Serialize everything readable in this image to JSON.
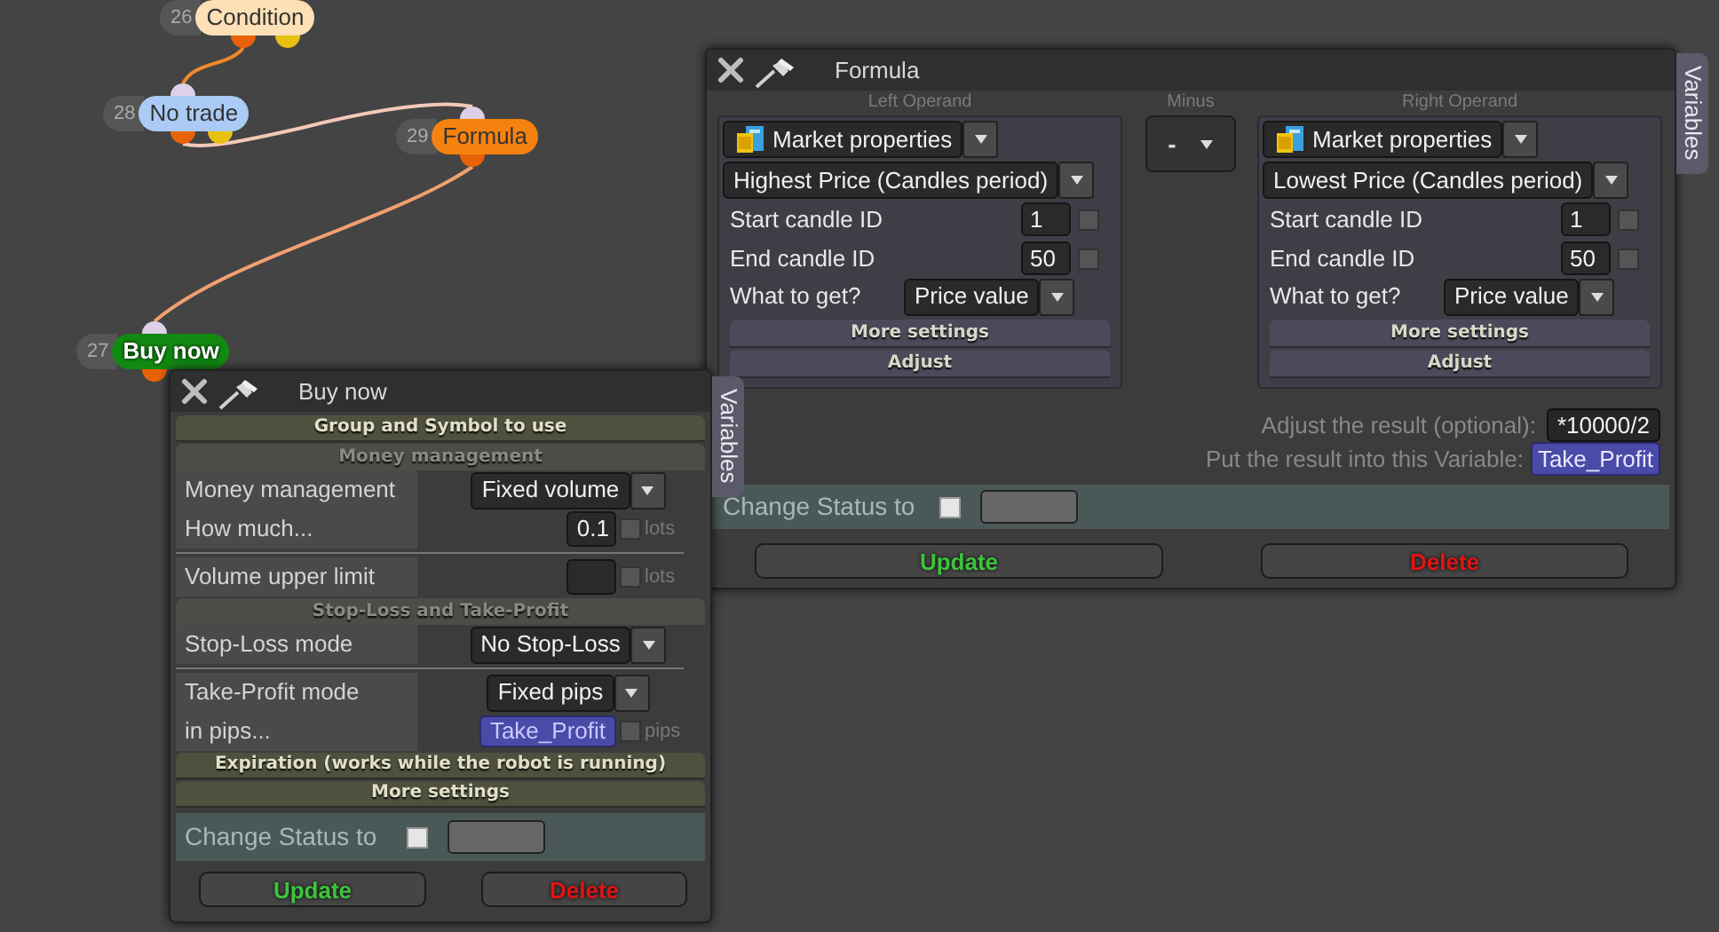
{
  "nodes": [
    {
      "number": "26",
      "label": "Condition",
      "color": "#fde0b5",
      "kind": "light"
    },
    {
      "number": "28",
      "label": "No trade",
      "color": "#aacbf5",
      "kind": "light"
    },
    {
      "number": "29",
      "label": "Formula",
      "color": "#f5820f",
      "kind": "light"
    },
    {
      "number": "27",
      "label": "Buy now",
      "color": "#128a12",
      "kind": "strong"
    }
  ],
  "formula_window": {
    "title": "Formula",
    "tab": "Variables",
    "operands": [
      {
        "label": "Left Operand",
        "source": "Market properties",
        "property": "Highest Price (Candles period)",
        "fields": [
          {
            "label": "Start candle ID",
            "value": "1",
            "checked": false
          },
          {
            "label": "End candle ID",
            "value": "50",
            "checked": false
          }
        ],
        "what_label": "What to get?",
        "what_value": "Price value",
        "sections": [
          "More settings",
          "Adjust"
        ]
      },
      {
        "label": "Right Operand",
        "source": "Market properties",
        "property": "Lowest Price (Candles period)",
        "fields": [
          {
            "label": "Start candle ID",
            "value": "1",
            "checked": false
          },
          {
            "label": "End candle ID",
            "value": "50",
            "checked": false
          }
        ],
        "what_label": "What to get?",
        "what_value": "Price value",
        "sections": [
          "More settings",
          "Adjust"
        ]
      }
    ],
    "operator": {
      "label": "Minus",
      "value": "-"
    },
    "adjust": {
      "label": "Adjust the result (optional):",
      "value": "*10000/2"
    },
    "result": {
      "label": "Put the result into this Variable:",
      "value": "Take_Profit"
    },
    "change_status": {
      "label": "Change Status to",
      "checked": false
    },
    "buttons": [
      {
        "label": "Update",
        "kind": "update"
      },
      {
        "label": "Delete",
        "kind": "delete"
      }
    ]
  },
  "buy_window": {
    "title": "Buy now",
    "tab": "Variables",
    "sections": [
      {
        "title": "Group and Symbol to use",
        "expanded": false
      },
      {
        "title": "Money management",
        "expanded": true,
        "groups": [
          [
            {
              "kind": "select",
              "label": "Money management",
              "value": "Fixed volume"
            },
            {
              "kind": "number",
              "label": "How much...",
              "value": "0.1",
              "unit": "lots",
              "checked": false
            }
          ],
          [
            {
              "kind": "number",
              "label": "Volume upper limit",
              "unit": "lots",
              "checked": false
            }
          ]
        ]
      },
      {
        "title": "Stop-Loss and Take-Profit",
        "expanded": true,
        "groups": [
          [
            {
              "kind": "select",
              "label": "Stop-Loss mode",
              "value": "No Stop-Loss"
            }
          ],
          [
            {
              "kind": "select",
              "label": "Take-Profit mode",
              "value": "Fixed pips"
            },
            {
              "kind": "variable",
              "label": "in pips...",
              "value": "Take_Profit",
              "unit": "pips",
              "checked": false
            }
          ]
        ]
      },
      {
        "title": "Expiration (works while the robot is running)",
        "expanded": false
      },
      {
        "title": "More settings",
        "expanded": false
      }
    ],
    "change_status": {
      "label": "Change Status to",
      "checked": false
    },
    "buttons": [
      {
        "label": "Update",
        "kind": "update"
      },
      {
        "label": "Delete",
        "kind": "delete"
      }
    ]
  }
}
